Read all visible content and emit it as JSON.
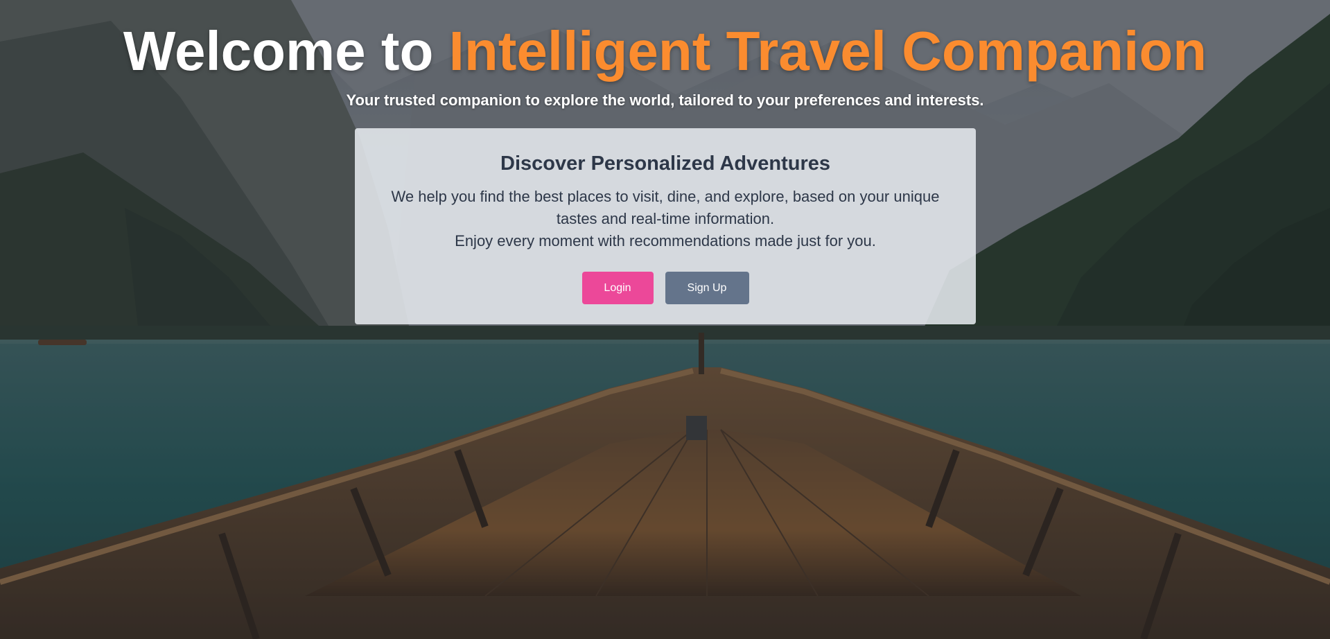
{
  "hero": {
    "title_prefix": "Welcome to ",
    "title_accent": "Intelligent Travel Companion",
    "subtitle": "Your trusted companion to explore the world, tailored to your preferences and interests."
  },
  "card": {
    "title": "Discover Personalized Adventures",
    "line1": "We help you find the best places to visit, dine, and explore, based on your unique tastes and real-time information.",
    "line2": "Enjoy every moment with recommendations made just for you."
  },
  "buttons": {
    "login_label": "Login",
    "signup_label": "Sign Up"
  },
  "colors": {
    "accent": "#fb8c2f",
    "login": "#ec4899",
    "signup": "#64748b",
    "card_bg": "#e5e9ee",
    "text_dark": "#2d3748"
  },
  "background": {
    "scene": "mountain lake viewed from the bow of a wooden rowboat"
  }
}
